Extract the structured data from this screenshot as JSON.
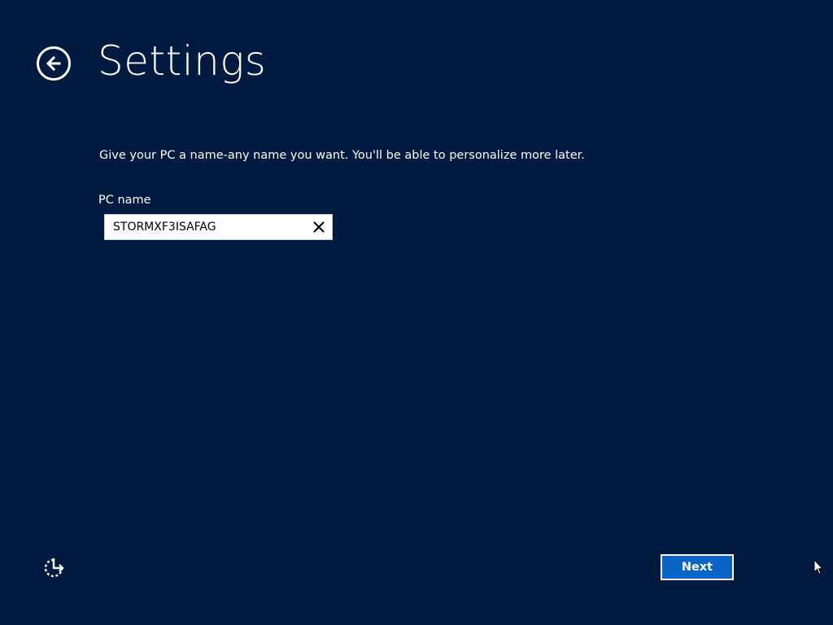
{
  "header": {
    "title": "Settings",
    "back_icon": "back-arrow-icon"
  },
  "form": {
    "instructions": "Give your PC a name-any name you want. You'll be able to personalize more later.",
    "pc_name_label": "PC name",
    "pc_name_value": "STORMXF3ISAFAG",
    "clear_icon": "close-icon"
  },
  "footer": {
    "ease_of_access_icon": "ease-of-access-icon",
    "next_label": "Next"
  },
  "colors": {
    "background": "#001a40",
    "accent": "#0a64c8",
    "text": "#ffffff"
  }
}
